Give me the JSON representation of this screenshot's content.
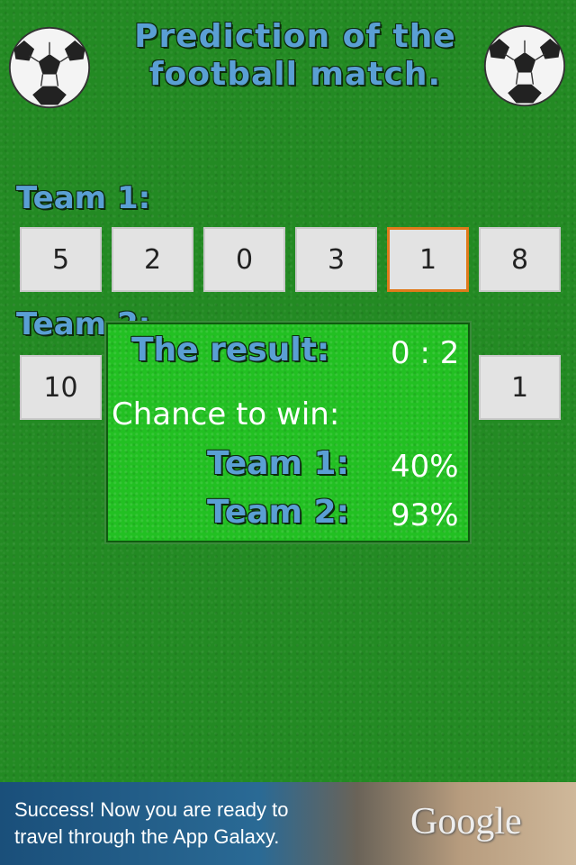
{
  "header": {
    "title_line1": "Prediction of the",
    "title_line2": "football match."
  },
  "team1": {
    "label": "Team 1:",
    "buttons": [
      "5",
      "2",
      "0",
      "3",
      "1",
      "8"
    ],
    "selected_index": 4
  },
  "team2": {
    "label": "Team 2:",
    "buttons": [
      "10",
      "",
      "",
      "",
      "",
      "1"
    ]
  },
  "result_dialog": {
    "result_label": "The result:",
    "result_value": "0 : 2",
    "chance_text": "Chance to win:",
    "team1_label": "Team 1:",
    "team1_value": "40%",
    "team2_label": "Team 2:",
    "team2_value": "93%"
  },
  "ad": {
    "line1": "Success! Now you are ready to",
    "line2": "travel through the App Galaxy.",
    "logo": "Google"
  },
  "colors": {
    "background": "#238a23",
    "dialog": "#22c022",
    "title_text": "#5a9fd4",
    "selected_border": "#e07a1a"
  },
  "icons": {
    "ball": "soccer-ball-icon"
  }
}
